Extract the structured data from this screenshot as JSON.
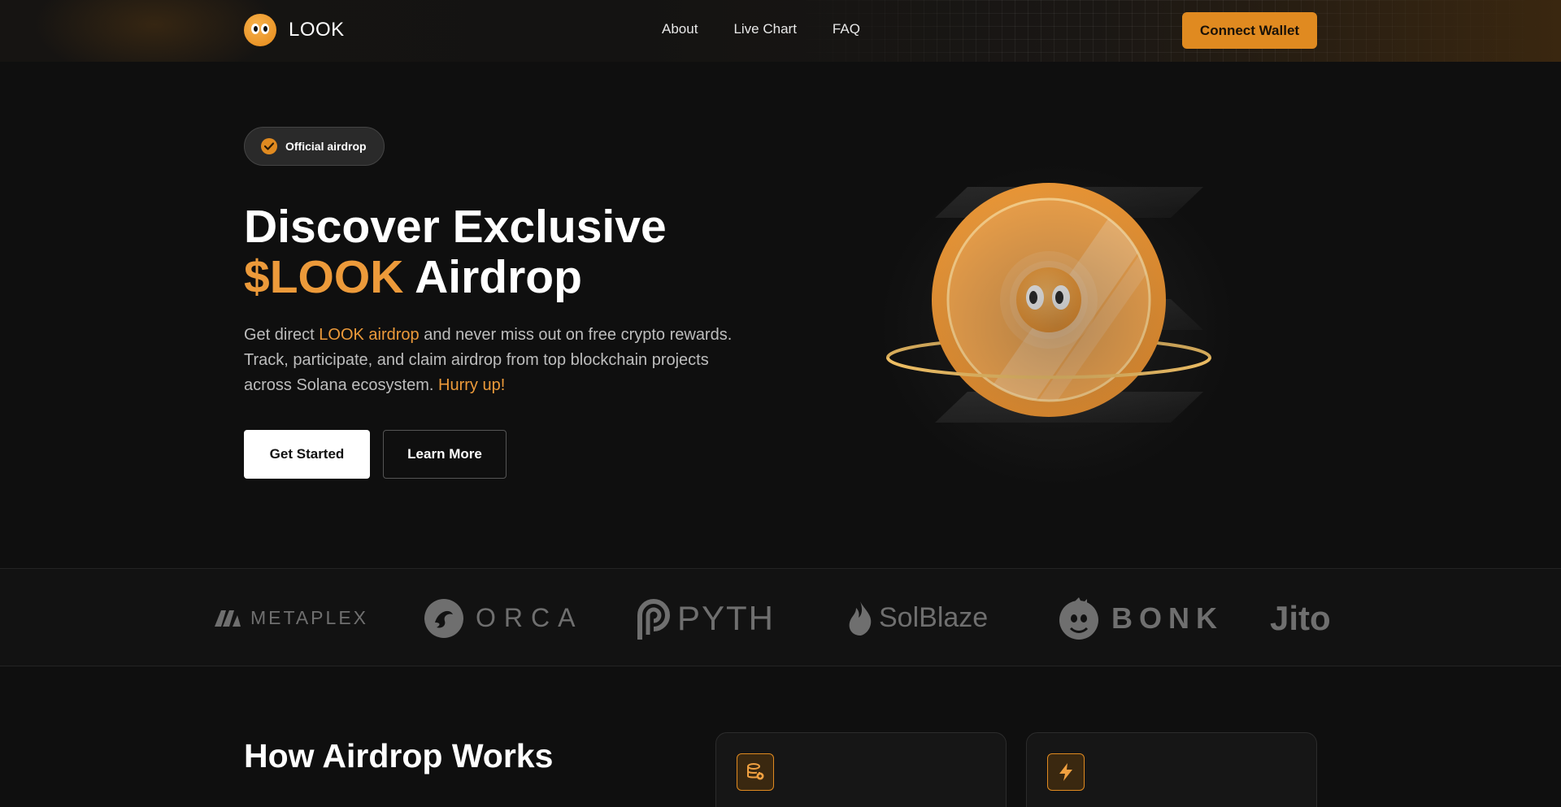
{
  "brand": {
    "name": "LOOK",
    "accent_color": "#e08a20"
  },
  "nav": {
    "items": [
      {
        "label": "About"
      },
      {
        "label": "Live Chart"
      },
      {
        "label": "FAQ"
      }
    ],
    "connect_label": "Connect Wallet"
  },
  "hero": {
    "badge": "Official airdrop",
    "title_line1": "Discover Exclusive",
    "title_accent": "$LOOK",
    "title_rest": " Airdrop",
    "desc_1": " Get direct ",
    "desc_accent": "LOOK airdrop",
    "desc_2": " and never miss out on free crypto rewards. Track, participate, and claim airdrop from top blockchain projects across Solana ecosystem. ",
    "desc_cta": "Hurry up!",
    "btn_primary": "Get Started",
    "btn_secondary": "Learn More"
  },
  "partners": [
    {
      "name": "METAPLEX",
      "icon": "metaplex-icon"
    },
    {
      "name": "ORCA",
      "icon": "orca-icon"
    },
    {
      "name": "PYTH",
      "icon": "pyth-icon"
    },
    {
      "name": "SolBlaze",
      "icon": "flame-icon"
    },
    {
      "name": "BONK",
      "icon": "bonk-dog-icon"
    },
    {
      "name": "Jito",
      "icon": ""
    }
  ],
  "how": {
    "title": "How Airdrop Works",
    "cards": [
      {
        "icon": "coin-stack-icon"
      },
      {
        "icon": "lightning-icon"
      }
    ]
  }
}
